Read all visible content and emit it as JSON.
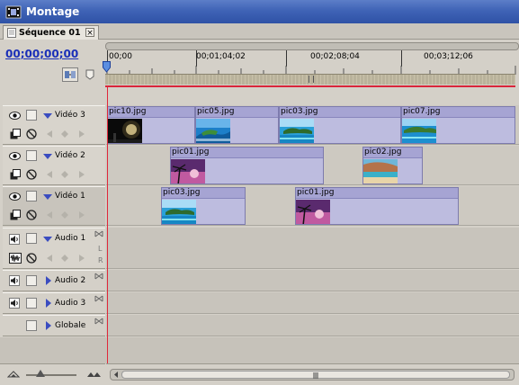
{
  "window": {
    "title": "Montage"
  },
  "tabs": [
    {
      "label": "Séquence 01",
      "close": "×"
    }
  ],
  "timecode": "00;00;00;00",
  "ruler": {
    "labels": [
      "00;00",
      "00;01;04;02",
      "00;02;08;04",
      "00;03;12;06"
    ]
  },
  "tracks": [
    {
      "id": "video3",
      "label": "Vidéo 3",
      "type": "video",
      "expanded": true,
      "clips": [
        {
          "name": "pic10.jpg",
          "thumb": "night"
        },
        {
          "name": "pic05.jpg",
          "thumb": "island"
        },
        {
          "name": "pic03.jpg",
          "thumb": "lagoon"
        },
        {
          "name": "pic07.jpg",
          "thumb": "lagoon"
        }
      ]
    },
    {
      "id": "video2",
      "label": "Vidéo 2",
      "type": "video",
      "expanded": true,
      "clips": [
        {
          "name": "pic01.jpg",
          "thumb": "palm"
        },
        {
          "name": "pic02.jpg",
          "thumb": "beach"
        }
      ]
    },
    {
      "id": "video1",
      "label": "Vidéo 1",
      "type": "video",
      "expanded": true,
      "clips": [
        {
          "name": "pic03.jpg",
          "thumb": "lagoon"
        },
        {
          "name": "pic01.jpg",
          "thumb": "palm"
        }
      ]
    },
    {
      "id": "audio1",
      "label": "Audio 1",
      "type": "audio",
      "expanded": true,
      "channels": [
        "L",
        "R"
      ],
      "clips": []
    },
    {
      "id": "audio2",
      "label": "Audio 2",
      "type": "audio",
      "expanded": false,
      "clips": []
    },
    {
      "id": "audio3",
      "label": "Audio 3",
      "type": "audio",
      "expanded": false,
      "clips": []
    },
    {
      "id": "master",
      "label": "Globale",
      "type": "master",
      "expanded": false,
      "clips": []
    }
  ],
  "colors": {
    "titlebar": "#3f63b6",
    "clip_body": "#bdbcdf",
    "clip_header": "#a6a4d3",
    "playhead": "#e0283a",
    "timecode": "#1a2fb8"
  },
  "icons": [
    "app-icon",
    "sequence-icon",
    "close-icon",
    "snap-icon",
    "marker-icon",
    "eye-icon",
    "speaker-icon",
    "lock-icon",
    "collapse-triangle-icon",
    "expand-triangle-icon",
    "display-style-icon",
    "keyframe-toggle-icon",
    "prev-keyframe-icon",
    "add-keyframe-icon",
    "next-keyframe-icon",
    "sync-lock-icon",
    "zoom-out-icon",
    "zoom-in-icon"
  ]
}
